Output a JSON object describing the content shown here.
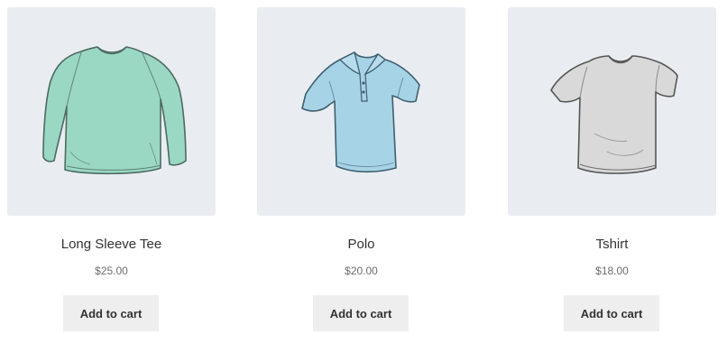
{
  "products": [
    {
      "title": "Long Sleeve Tee",
      "price": "$25.00",
      "button_label": "Add to cart",
      "image": "long-sleeve-tee-illustration",
      "color": "#9ad8c4"
    },
    {
      "title": "Polo",
      "price": "$20.00",
      "button_label": "Add to cart",
      "image": "polo-shirt-illustration",
      "color": "#a7d3e6"
    },
    {
      "title": "Tshirt",
      "price": "$18.00",
      "button_label": "Add to cart",
      "image": "tshirt-illustration",
      "color": "#d9d9d9"
    }
  ],
  "colors": {
    "card_background": "#e9edf2",
    "button_background": "#eeeeee",
    "title_text": "#333333",
    "price_text": "#6d6d6d"
  }
}
